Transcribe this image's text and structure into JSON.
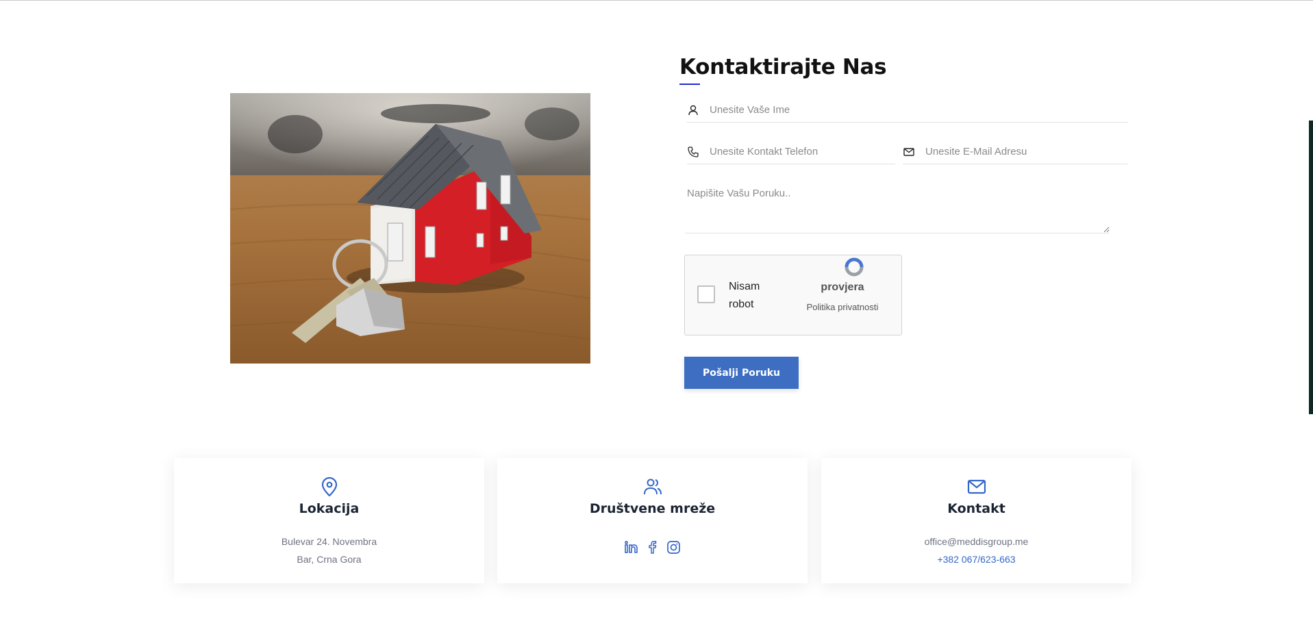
{
  "colors": {
    "accent": "#3d6ec2",
    "title_underline": "#1f2bd0",
    "link": "#3566c8"
  },
  "contact_form": {
    "title": "Kontaktirajte Nas",
    "name_placeholder": "Unesite Vaše Ime",
    "phone_placeholder": "Unesite Kontakt Telefon",
    "email_placeholder": "Unesite E-Mail Adresu",
    "message_placeholder": "Napišite Vašu Poruku..",
    "submit_label": "Pošalji Poruku",
    "icons": [
      "user-icon",
      "phone-icon",
      "envelope-icon"
    ]
  },
  "captcha": {
    "checkbox_label": "Nisam robot",
    "brand": "provjera",
    "policy": "Politika privatnosti",
    "checked": false
  },
  "info_cards": [
    {
      "icon": "map-pin-icon",
      "title": "Lokacija",
      "lines": [
        "Bulevar 24. Novembra",
        "Bar, Crna Gora"
      ]
    },
    {
      "icon": "users-icon",
      "title": "Društvene mreže",
      "socials": [
        "linkedin-icon",
        "facebook-icon",
        "instagram-icon"
      ]
    },
    {
      "icon": "mail-icon",
      "title": "Kontakt",
      "lines": [
        "office@meddisgroup.me",
        "+382 067/623-663"
      ]
    }
  ]
}
